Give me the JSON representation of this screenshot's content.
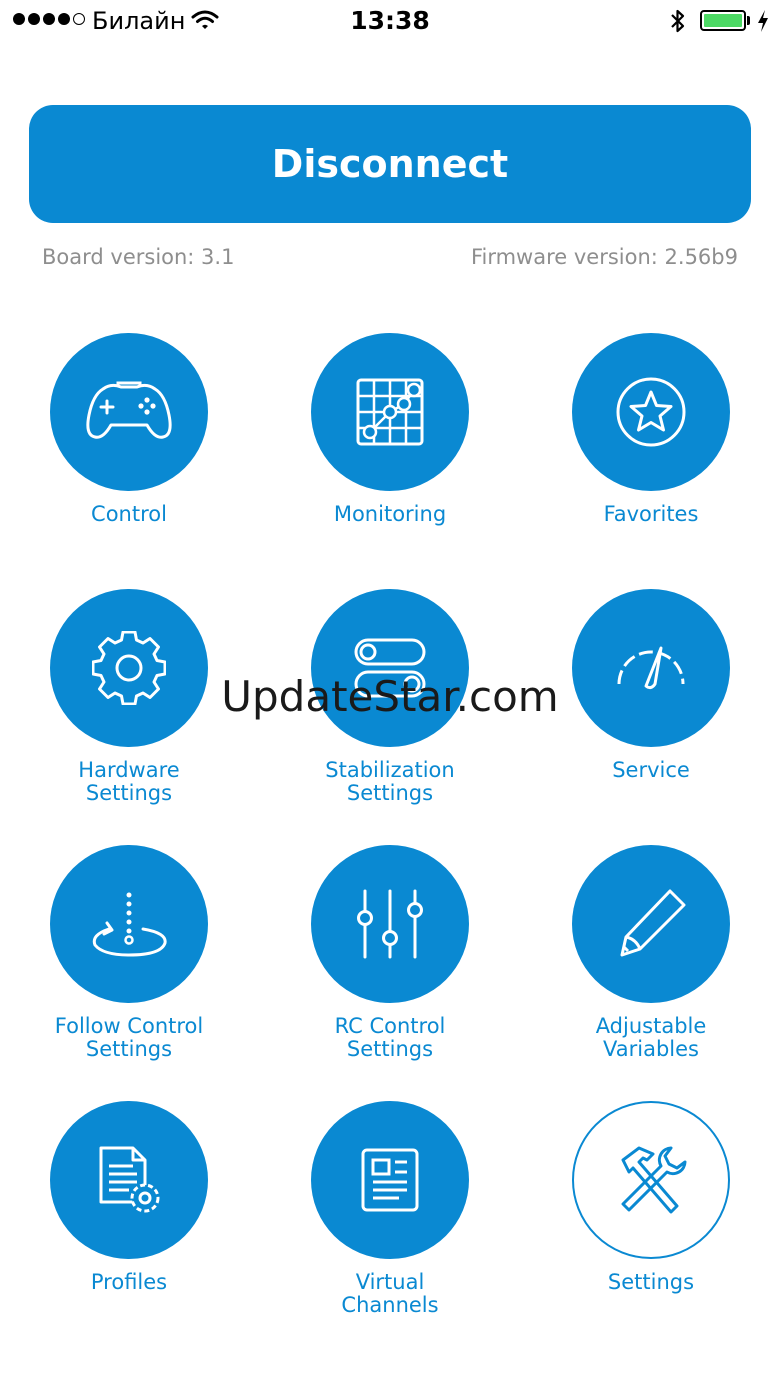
{
  "status_bar": {
    "carrier": "Билайн",
    "time": "13:38",
    "signal_bars": 4
  },
  "colors": {
    "accent": "#0a89d2",
    "battery": "#4cd964",
    "muted_text": "#8e8e8e"
  },
  "disconnect_label": "Disconnect",
  "board_version": "Board version: 3.1",
  "firmware_version": "Firmware version: 2.56b9",
  "menu": [
    {
      "label": "Control",
      "icon": "gamepad-icon"
    },
    {
      "label": "Monitoring",
      "icon": "grid-chart-icon"
    },
    {
      "label": "Favorites",
      "icon": "star-icon"
    },
    {
      "label": "Hardware\nSettings",
      "icon": "gear-icon"
    },
    {
      "label": "Stabilization\nSettings",
      "icon": "toggle-switches-icon"
    },
    {
      "label": "Service",
      "icon": "gauge-icon"
    },
    {
      "label": "Follow Control\nSettings",
      "icon": "follow-rotate-icon"
    },
    {
      "label": "RC Control\nSettings",
      "icon": "sliders-icon"
    },
    {
      "label": "Adjustable\nVariables",
      "icon": "pencil-icon"
    },
    {
      "label": "Profiles",
      "icon": "document-gear-icon"
    },
    {
      "label": "Virtual\nChannels",
      "icon": "news-document-icon"
    },
    {
      "label": "Settings",
      "icon": "hammer-wrench-icon"
    }
  ],
  "watermark": "UpdateStar.com"
}
